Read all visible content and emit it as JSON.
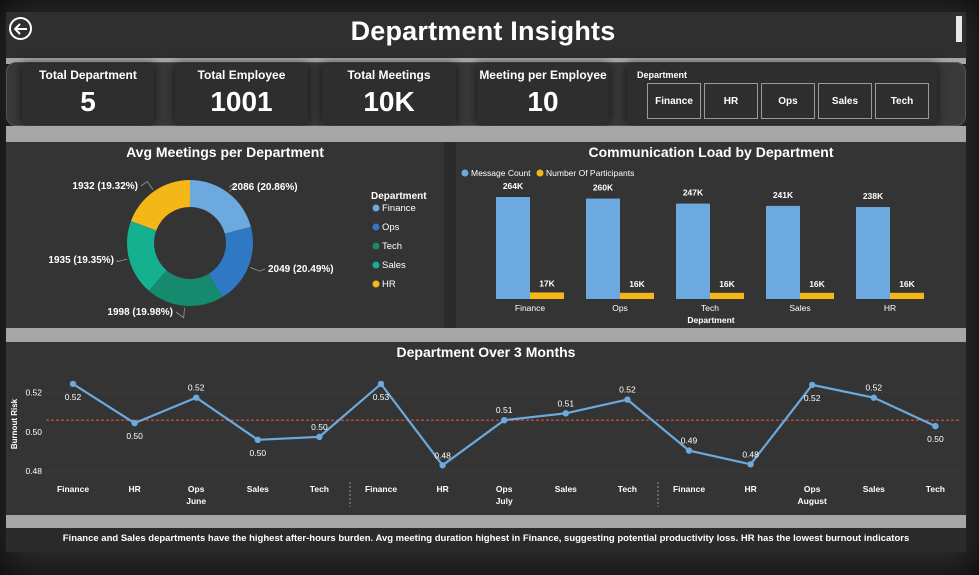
{
  "header": {
    "title": "Department Insights"
  },
  "kpis": [
    {
      "label": "Total Department",
      "value": "5"
    },
    {
      "label": "Total Employee",
      "value": "1001"
    },
    {
      "label": "Total Meetings",
      "value": "10K"
    },
    {
      "label": "Meeting per Employee",
      "value": "10"
    }
  ],
  "slicer": {
    "caption": "Department",
    "options": [
      "Finance",
      "HR",
      "Ops",
      "Sales",
      "Tech"
    ]
  },
  "colors": {
    "Finance": "#6CA9DE",
    "Ops": "#2F78C4",
    "Tech": "#168A6C",
    "Sales": "#14B090",
    "HR": "#F5B617",
    "message": "#6CA9DE",
    "participants": "#F5B617",
    "line": "#6CA9DE",
    "ref_line": "#B04A3A"
  },
  "chart_data": [
    {
      "type": "pie",
      "title": "Avg Meetings per Department",
      "legend_title": "Department",
      "legend": [
        "Finance",
        "Ops",
        "Tech",
        "Sales",
        "HR"
      ],
      "slices": [
        {
          "name": "Finance",
          "value": 2086,
          "label": "2086 (20.86%)"
        },
        {
          "name": "Ops",
          "value": 2049,
          "label": "2049 (20.49%)"
        },
        {
          "name": "Tech",
          "value": 1998,
          "label": "1998 (19.98%)"
        },
        {
          "name": "Sales",
          "value": 1935,
          "label": "1935 (19.35%)"
        },
        {
          "name": "HR",
          "value": 1932,
          "label": "1932 (19.32%)"
        }
      ]
    },
    {
      "type": "bar",
      "title": "Communication Load by Department",
      "xlabel": "Department",
      "categories": [
        "Finance",
        "Ops",
        "Tech",
        "Sales",
        "HR"
      ],
      "series": [
        {
          "name": "Message Count",
          "values": [
            264,
            260,
            247,
            241,
            238
          ],
          "labels": [
            "264K",
            "260K",
            "247K",
            "241K",
            "238K"
          ]
        },
        {
          "name": "Number Of Participants",
          "values": [
            17,
            16,
            16,
            16,
            16
          ],
          "labels": [
            "17K",
            "16K",
            "16K",
            "16K",
            "16K"
          ]
        }
      ],
      "ylim": [
        0,
        290
      ]
    },
    {
      "type": "line",
      "title": "Department Over 3 Months",
      "ylabel": "Burnout Risk",
      "yticks": [
        "0.52",
        "0.50",
        "0.48"
      ],
      "ytick_values": [
        0.52,
        0.5,
        0.48
      ],
      "ylim": [
        0.4755,
        0.5265
      ],
      "reference_line": 0.506,
      "groups": [
        {
          "name": "June",
          "categories": [
            "Finance",
            "HR",
            "Ops",
            "Sales",
            "Tech"
          ]
        },
        {
          "name": "July",
          "categories": [
            "Finance",
            "HR",
            "Ops",
            "Sales",
            "Tech"
          ]
        },
        {
          "name": "August",
          "categories": [
            "Finance",
            "HR",
            "Ops",
            "Sales",
            "Tech"
          ]
        }
      ],
      "values": [
        0.5245,
        0.5045,
        0.5175,
        0.496,
        0.4975,
        0.5245,
        0.483,
        0.506,
        0.5095,
        0.5165,
        0.4905,
        0.4835,
        0.524,
        0.5175,
        0.503
      ],
      "labels": [
        "0.52",
        "0.50",
        "0.52",
        "0.50",
        "0.50",
        "0.53",
        "0.48",
        "0.51",
        "0.51",
        "0.52",
        "0.49",
        "0.48",
        "0.52",
        "0.52",
        "0.50"
      ],
      "label_pos": [
        "below",
        "below",
        "above",
        "below",
        "above",
        "below",
        "above",
        "above",
        "above",
        "above",
        "above",
        "above",
        "below",
        "above",
        "below"
      ]
    }
  ],
  "footer": {
    "text": "Finance and Sales departments have the highest after-hours burden. Avg meeting duration highest in Finance, suggesting potential productivity loss. HR has the lowest burnout indicators"
  }
}
